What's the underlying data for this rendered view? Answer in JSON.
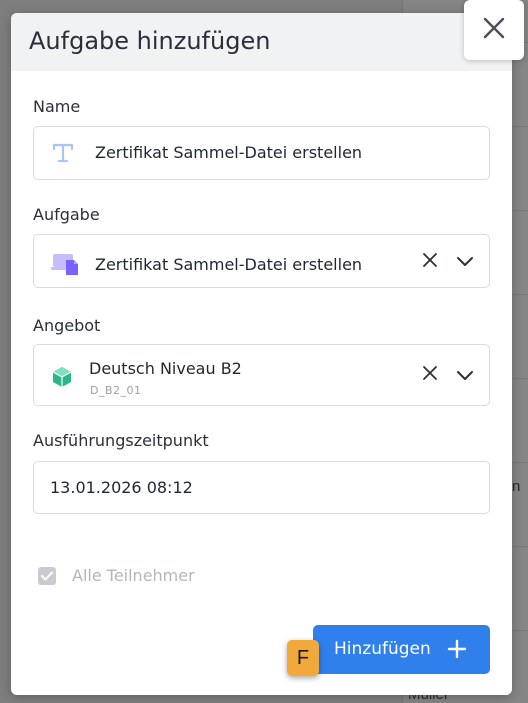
{
  "background": {
    "partial_text_right": "n",
    "partial_text_bottom": "Müller"
  },
  "dialog": {
    "title": "Aufgabe hinzufügen",
    "close_icon": "close-icon"
  },
  "fields": {
    "name": {
      "label": "Name",
      "value": "Zertifikat Sammel-Datei erstellen",
      "icon": "text-type-icon"
    },
    "aufgabe": {
      "label": "Aufgabe",
      "value": "Zertifikat Sammel-Datei erstellen",
      "icon": "task-file-icon"
    },
    "angebot": {
      "label": "Angebot",
      "value": "Deutsch Niveau B2",
      "sub": "D_B2_01",
      "icon": "cube-icon"
    },
    "zeitpunkt": {
      "label": "Ausführungszeitpunkt",
      "value": "13.01.2026 08:12"
    }
  },
  "checkbox": {
    "label": "Alle Teilnehmer",
    "checked": true,
    "disabled": true
  },
  "submit": {
    "label": "Hinzufügen",
    "icon": "plus-icon"
  },
  "hint": {
    "key": "F"
  },
  "colors": {
    "accent": "#2f80ed",
    "hint_badge": "#f2a93b",
    "cube_green": "#2bb58a",
    "task_purple": "#7b61ff"
  }
}
